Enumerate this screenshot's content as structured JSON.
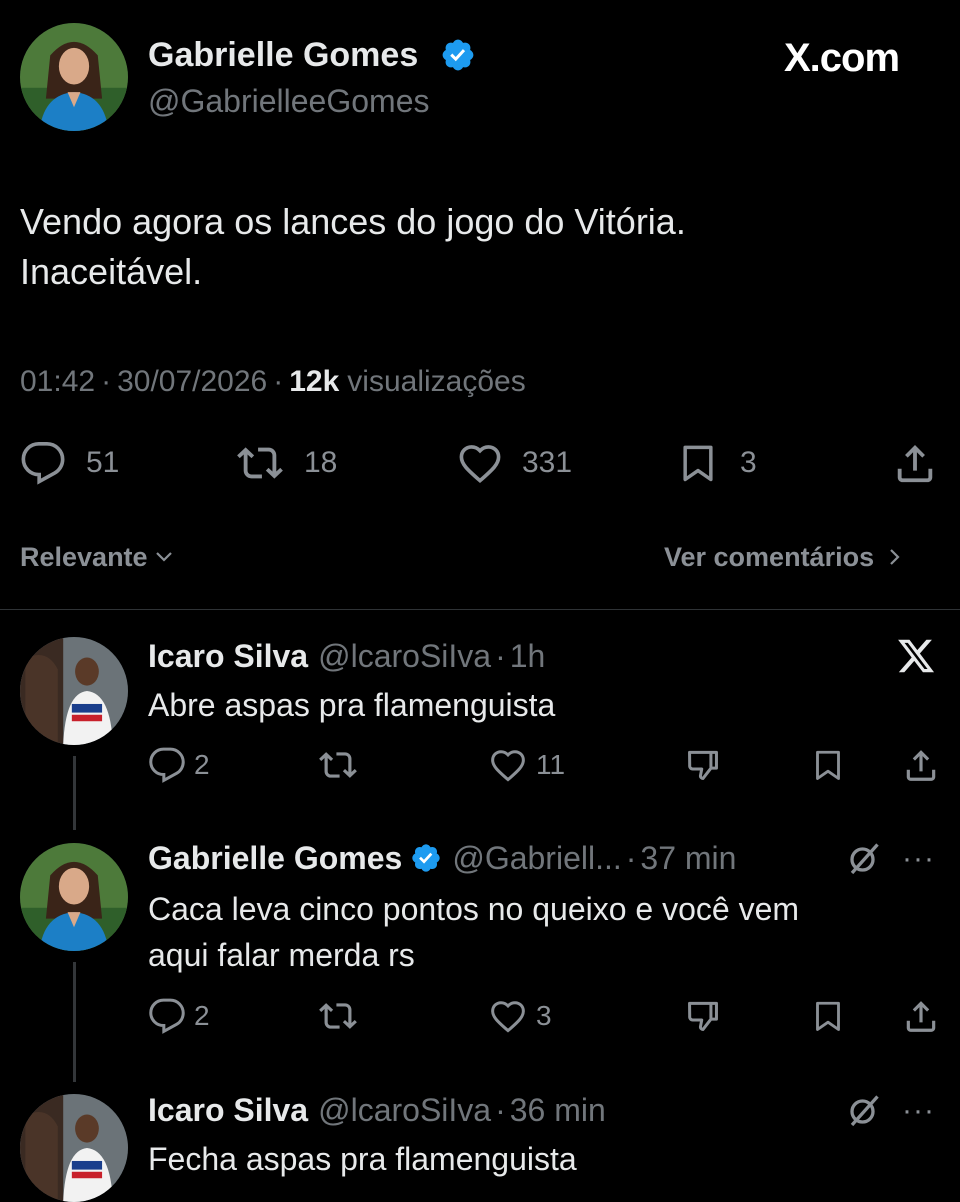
{
  "brand": {
    "logo_text": "X.com"
  },
  "main_tweet": {
    "author_name": "Gabrielle Gomes",
    "handle": "@GabrielleeGomes",
    "text_line1": "Vendo agora os lances do jogo do Vitória.",
    "text_line2": "Inaceitável.",
    "time": "01:42",
    "date": "30/07/2026",
    "views_count": "12k",
    "views_label": "visualizações",
    "stats": {
      "replies": "51",
      "retweets": "18",
      "likes": "331",
      "bookmarks": "3"
    }
  },
  "sort": {
    "label": "Relevante",
    "see_comments": "Ver comentários"
  },
  "replies": [
    {
      "author_name": "Icaro Silva",
      "handle": "@lcaroSiIva",
      "time": "1h",
      "text": "Abre aspas pra flamenguista",
      "stats": {
        "replies": "2",
        "likes": "11"
      }
    },
    {
      "author_name": "Gabrielle Gomes",
      "handle": "@Gabriell...",
      "time": "37 min",
      "text_line1": "Caca leva cinco pontos no queixo e você vem",
      "text_line2": "aqui falar merda rs",
      "stats": {
        "replies": "2",
        "likes": "3"
      }
    },
    {
      "author_name": "Icaro Silva",
      "handle": "@lcaroSiIva",
      "time": "36 min",
      "text": "Fecha aspas pra flamenguista"
    }
  ],
  "colors": {
    "background": "#000000",
    "text": "#e7e9ea",
    "muted": "#71767b",
    "verified": "#1d9bf0"
  }
}
